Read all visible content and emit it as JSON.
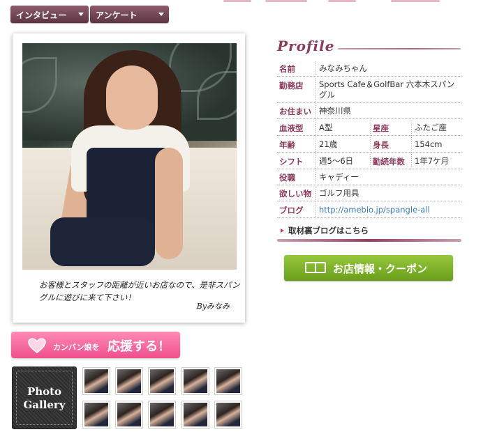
{
  "tabs": [
    {
      "label": "インタビュー"
    },
    {
      "label": "アンケート"
    }
  ],
  "photo_caption": {
    "message": "お客様とスタッフの距離が近いお店なので、是非スパングルに遊びに来て下さい！",
    "signature": "Byみなみ"
  },
  "support_button": {
    "prefix": "カンバン娘を",
    "main": "応援する！"
  },
  "gallery": {
    "label_line1": "Photo",
    "label_line2": "Gallery"
  },
  "profile": {
    "title": "Profile",
    "rows": [
      {
        "label": "名前",
        "value": "みなみちゃん"
      },
      {
        "label": "勤務店",
        "value": "Sports Cafe＆GolfBar 六本木スパングル"
      },
      {
        "label": "お住まい",
        "value": "神奈川県"
      },
      {
        "label": "血液型",
        "value": "A型",
        "label2": "星座",
        "value2": "ふたご座"
      },
      {
        "label": "年齢",
        "value": "21歳",
        "label2": "身長",
        "value2": "154cm"
      },
      {
        "label": "シフト",
        "value": "週5〜6日",
        "label2": "勤続年数",
        "value2": "1年7ケ月"
      },
      {
        "label": "役職",
        "value": "キャディー"
      },
      {
        "label": "欲しい物",
        "value": "ゴルフ用具"
      },
      {
        "label": "ブログ",
        "value": "http://ameblo.jp/spangle-all"
      }
    ],
    "behind_link": "取材裏ブログはこちら"
  },
  "shop_button": {
    "label": "お店情報・クーポン"
  },
  "colors": {
    "tab": "#6e4051",
    "accent": "#8c3b5c",
    "support_pink": "#f0508d",
    "shop_green": "#7db02a",
    "link_blue": "#3b7fc4"
  }
}
